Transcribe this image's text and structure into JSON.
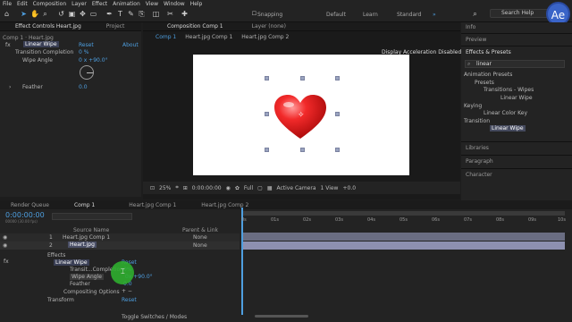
{
  "menu": [
    "File",
    "Edit",
    "Composition",
    "Layer",
    "Effect",
    "Animation",
    "View",
    "Window",
    "Help"
  ],
  "toolbar": {
    "snapping": "Snapping",
    "workspaces": [
      "Default",
      "Learn",
      "Standard"
    ],
    "search_placeholder": "Search Help",
    "logo_text": "Ae"
  },
  "effect_controls": {
    "tabs": [
      "Effect Controls Heart.jpg",
      "Project"
    ],
    "crumb": "Comp 1 · Heart.jpg",
    "effect_name": "Linear Wipe",
    "reset": "Reset",
    "about": "About",
    "props": [
      {
        "label": "Transition Completion",
        "value": "0 %"
      },
      {
        "label": "Wipe Angle",
        "value": "0 x +90.0°"
      },
      {
        "label": "Feather",
        "value": "0.0"
      }
    ]
  },
  "composition": {
    "tab": "Composition Comp 1",
    "sub_tabs": [
      "Comp 1",
      "Heart.jpg Comp 1",
      "Heart.jpg Comp 2"
    ],
    "layer_tab": "Layer (none)",
    "display_note": "Display Acceleration Disabled",
    "zoom": "25%",
    "time": "0:00:00:00",
    "resolution": "Full",
    "camera": "Active Camera",
    "view": "1 View",
    "exposure": "+0.0"
  },
  "right_panel": {
    "info": "Info",
    "preview": "Preview",
    "effects_presets": "Effects & Presets",
    "search_value": "linear",
    "tree": [
      {
        "label": "Animation Presets",
        "level": 0
      },
      {
        "label": "Presets",
        "level": 1
      },
      {
        "label": "Transitions - Wipes",
        "level": 2
      },
      {
        "label": "Linear Wipe",
        "level": 3
      },
      {
        "label": "Keying",
        "level": 0
      },
      {
        "label": "Linear Color Key",
        "level": 1
      },
      {
        "label": "Transition",
        "level": 0
      },
      {
        "label": "Linear Wipe",
        "level": 1
      }
    ],
    "sections": [
      "Libraries",
      "Paragraph",
      "Character"
    ]
  },
  "timeline": {
    "tabs": [
      "Render Queue",
      "Comp 1",
      "Heart.jpg Comp 1",
      "Heart.jpg Comp 2"
    ],
    "time": "0:00:00:00",
    "fps": "00000 (30.00 fps)",
    "col_source": "Source Name",
    "col_parent": "Parent & Link",
    "layers": [
      {
        "num": "1",
        "name": "Heart.jpg Comp 1",
        "parent": "None"
      },
      {
        "num": "2",
        "name": "Heart.jpg",
        "parent": "None"
      }
    ],
    "effects": "Effects",
    "effect_name": "Linear Wipe",
    "reset": "Reset",
    "props": [
      {
        "label": "Transit...Completion",
        "value": "0%"
      },
      {
        "label": "Wipe Angle",
        "value": "0x +90.0°"
      },
      {
        "label": "Feather",
        "value": "0.0"
      }
    ],
    "compositing": "Compositing Options",
    "compositing_value": "+ −",
    "transform": "Transform",
    "transform_reset": "Reset",
    "toggle": "Toggle Switches / Modes",
    "ruler": [
      "0s",
      "01s",
      "02s",
      "03s",
      "04s",
      "05s",
      "06s",
      "07s",
      "08s",
      "09s",
      "10s"
    ]
  },
  "colors": {
    "accent": "#4e9fe0",
    "layer_bar": "#8d90b0",
    "green_cursor": "#2fae2f",
    "brand": "#3a64c8"
  }
}
